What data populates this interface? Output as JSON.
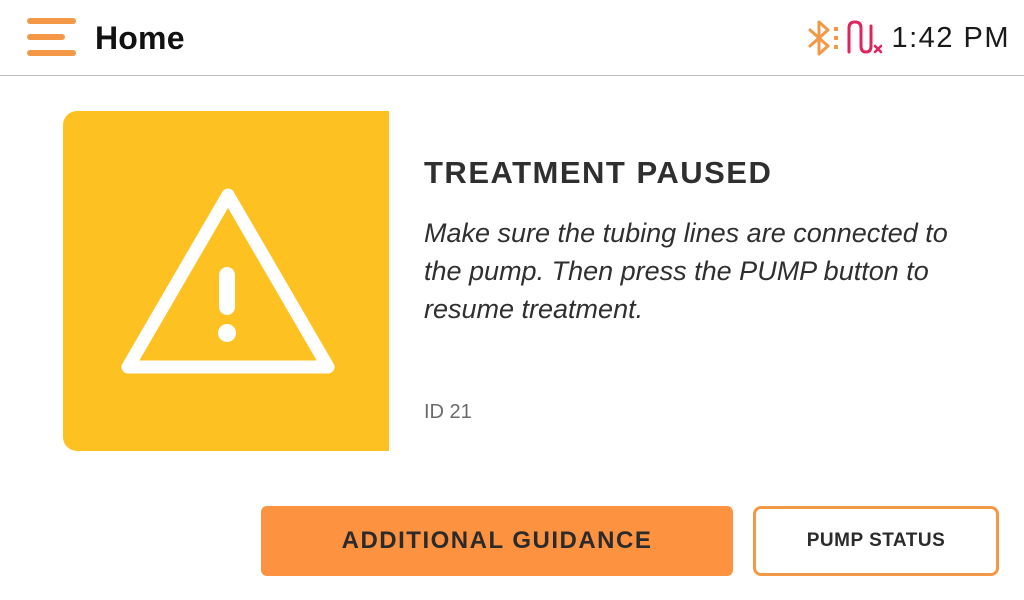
{
  "header": {
    "title": "Home",
    "menu_icon": "hamburger-menu-icon",
    "status": {
      "bluetooth_icon": "bluetooth-disconnected-icon",
      "pump_icon": "pump-disconnected-icon",
      "time": "1:42 PM"
    },
    "colors": {
      "accent": "#f39847",
      "pump_alert": "#e0245e"
    }
  },
  "alert": {
    "icon": "warning-triangle-icon",
    "tile_color": "#fdc121",
    "title": "TREATMENT PAUSED",
    "message": "Make sure the tubing lines are connected to the pump. Then press the PUMP button to resume treatment.",
    "id_text": "ID 21"
  },
  "actions": {
    "guidance_label": "ADDITIONAL GUIDANCE",
    "pump_status_label": "PUMP STATUS",
    "primary_color": "#fd9340"
  }
}
